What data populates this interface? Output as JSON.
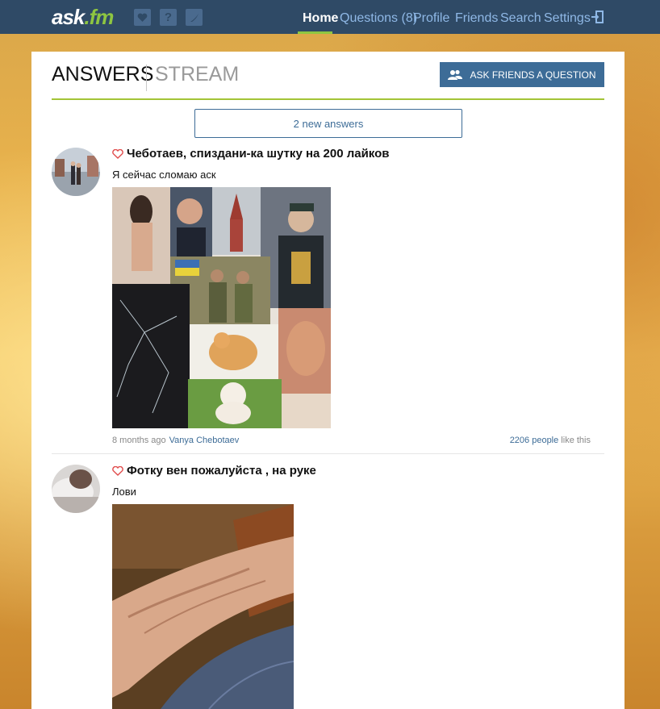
{
  "header": {
    "logo_main": "ask",
    "logo_accent": ".fm",
    "nav": [
      {
        "label": "Home",
        "active": true
      },
      {
        "label": "Questions (8)",
        "active": false
      },
      {
        "label": "Profile",
        "active": false
      },
      {
        "label": "Friends",
        "active": false
      },
      {
        "label": "Search",
        "active": false
      },
      {
        "label": "Settings",
        "active": false
      }
    ],
    "icons": [
      "heart-icon",
      "question-icon",
      "shoutout-icon",
      "logout-icon"
    ]
  },
  "tabs": {
    "answers": "ANSWERS",
    "stream": "STREAM"
  },
  "ask_friends_label": "ASK FRIENDS A QUESTION",
  "new_answers_label": "2 new answers",
  "posts": [
    {
      "question": "Чеботаев, спиздани-ка шутку на 200 лайков",
      "answer": "Я сейчас сломаю аск",
      "time": "8 months ago",
      "author": "Vanya Chebotaev",
      "likes_count": "2206 people",
      "likes_suffix": " like this"
    },
    {
      "question": "Фотку вен пожалуйста , на руке",
      "answer": "Лови"
    }
  ],
  "colors": {
    "topbar": "#2f4a66",
    "accent_green": "#8ec641",
    "link_blue": "#3d6c97",
    "nav_link": "#8fb8e6"
  }
}
